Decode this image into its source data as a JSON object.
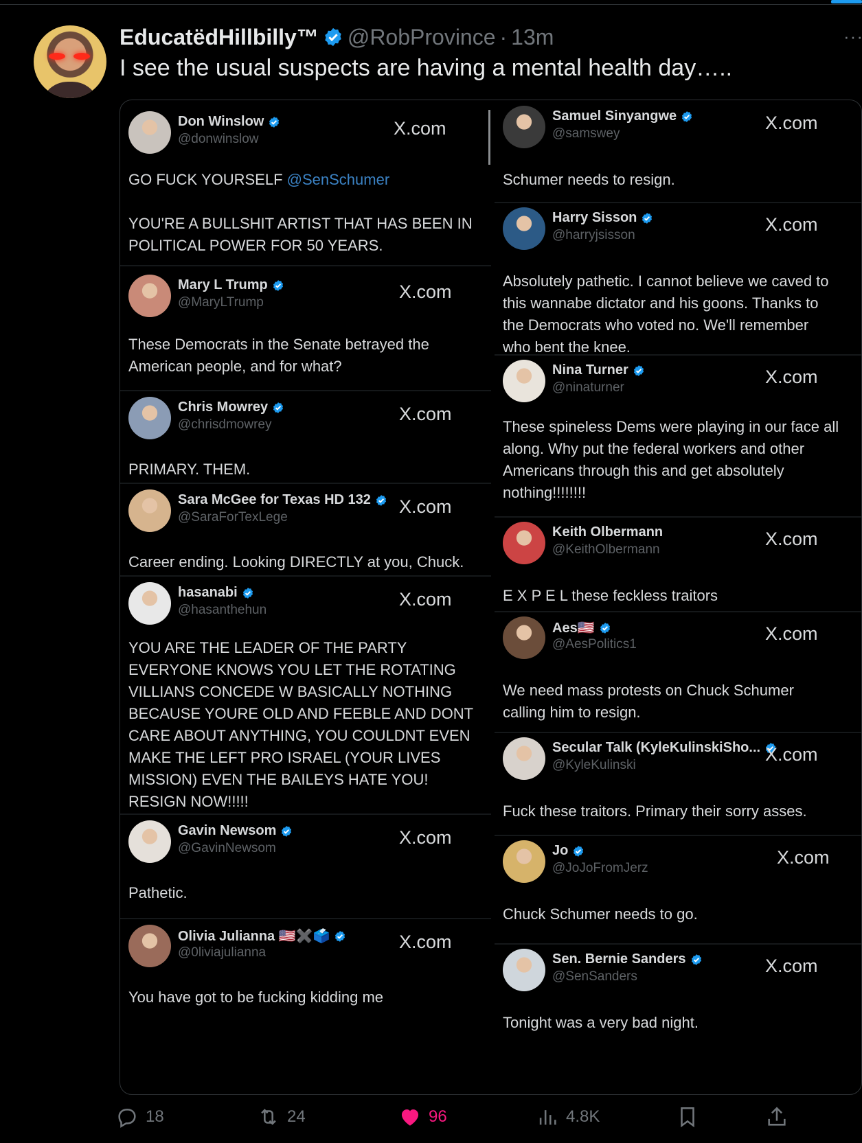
{
  "post": {
    "display_name": "EducatëdHillbilly™",
    "handle": "@RobProvince",
    "separator": "·",
    "time": "13m",
    "text": "I see the usual suspects are having a mental health day….."
  },
  "left_cards": [
    {
      "name": "Don Winslow",
      "handle": "@donwinslow",
      "source": "X.com",
      "lines": [
        "GO FUCK YOURSELF @SenSchumer",
        "",
        "YOU'RE A BULLSHIT ARTIST THAT HAS BEEN IN",
        "POLITICAL POWER FOR 50 YEARS."
      ]
    },
    {
      "name": "Mary L Trump",
      "handle": "@MaryLTrump",
      "source": "X.com",
      "lines": [
        "These Democrats in the Senate betrayed the",
        "American people, and for what?"
      ]
    },
    {
      "name": "Chris Mowrey",
      "handle": "@chrisdmowrey",
      "source": "X.com",
      "lines": [
        "PRIMARY. THEM."
      ]
    },
    {
      "name": "Sara McGee for Texas HD 132",
      "handle": "@SaraForTexLege",
      "source": "X.com",
      "lines": [
        "Career ending. Looking DIRECTLY at you, Chuck."
      ]
    },
    {
      "name": "hasanabi",
      "handle": "@hasanthehun",
      "source": "X.com",
      "lines": [
        "YOU ARE THE LEADER OF THE PARTY",
        "EVERYONE KNOWS YOU LET THE ROTATING",
        "VILLIANS CONCEDE W BASICALLY NOTHING",
        "BECAUSE YOURE OLD AND FEEBLE AND DONT",
        "CARE ABOUT ANYTHING, YOU COULDNT EVEN",
        "MAKE THE LEFT PRO ISRAEL (YOUR LIVES",
        "MISSION) EVEN THE BAILEYS HATE YOU!",
        "RESIGN NOW!!!!!"
      ]
    },
    {
      "name": "Gavin Newsom",
      "handle": "@GavinNewsom",
      "source": "X.com",
      "lines": [
        "Pathetic."
      ]
    },
    {
      "name": "Olivia Julianna 🇺🇸✖️🗳️",
      "handle": "@0liviajulianna",
      "source": "X.com",
      "lines": [
        "You have got to be fucking kidding me"
      ]
    }
  ],
  "right_cards": [
    {
      "name": "Samuel Sinyangwe",
      "handle": "@samswey",
      "source": "X.com",
      "lines": [
        "Schumer needs to resign."
      ]
    },
    {
      "name": "Harry Sisson",
      "handle": "@harryjsisson",
      "source": "X.com",
      "lines": [
        "Absolutely pathetic. I cannot believe we caved to",
        "this wannabe dictator and his goons. Thanks to",
        "the Democrats who voted no. We'll remember",
        "who bent the knee."
      ]
    },
    {
      "name": "Nina Turner",
      "handle": "@ninaturner",
      "source": "X.com",
      "lines": [
        "These spineless Dems were playing in our face all",
        "along. Why put the federal workers and other",
        "Americans through this and get absolutely",
        "nothing!!!!!!!!"
      ]
    },
    {
      "name": "Keith Olbermann",
      "handle": "@KeithOlbermann",
      "source": "X.com",
      "lines": [
        "E X P E L these feckless traitors"
      ]
    },
    {
      "name": "Aes🇺🇸",
      "handle": "@AesPolitics1",
      "source": "X.com",
      "lines": [
        "We need mass protests on Chuck Schumer",
        "calling him to resign."
      ]
    },
    {
      "name": "Secular Talk (KyleKulinskiSho...",
      "handle": "@KyleKulinski",
      "source": "X.com",
      "lines": [
        "Fuck these traitors. Primary their sorry asses."
      ]
    },
    {
      "name": "Jo",
      "handle": "@JoJoFromJerz",
      "source": "X.com",
      "lines": [
        "Chuck Schumer needs to go."
      ]
    },
    {
      "name": "Sen. Bernie Sanders",
      "handle": "@SenSanders",
      "source": "X.com",
      "lines": [
        "Tonight was a very bad night."
      ]
    }
  ],
  "actions": {
    "replies": "18",
    "reposts": "24",
    "likes": "96",
    "views": "4.8K"
  },
  "colors": {
    "background": "#000000",
    "verified": "#1d9bf0",
    "like": "#f91880",
    "muted": "#71767b"
  }
}
